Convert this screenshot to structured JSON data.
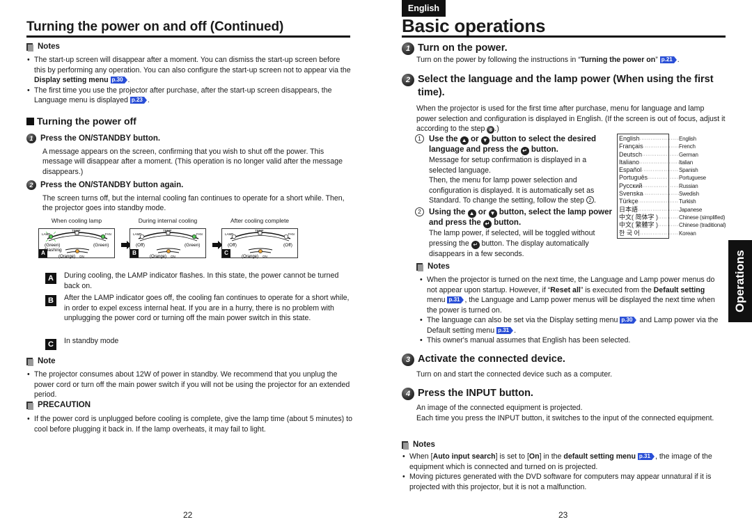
{
  "left_page": {
    "title": "Turning the power on and off (Continued)",
    "notes1": {
      "heading": "Notes",
      "items": [
        {
          "pre": "The start-up screen will disappear after a moment. You can dismiss the start-up screen before this by performing any operation. You can also configure the start-up screen not to appear via the ",
          "bold": "Display setting menu",
          "ref": "p.30",
          "post": "."
        },
        {
          "pre": "The first time you use the projector after purchase, after the start-up screen disappears, the Language menu is displayed",
          "bold": "",
          "ref": "p.23",
          "post": "."
        }
      ]
    },
    "section_off": {
      "heading": "Turning the power off",
      "steps": [
        {
          "num": "1",
          "title": "Press the ON/STANDBY button.",
          "text": "A message appears on the screen, confirming that you wish to shut off the power. This message will disappear after a moment. (This operation is no longer valid after the message disappears.)"
        },
        {
          "num": "2",
          "title": "Press the ON/STANDBY button again.",
          "text": "The screen turns off, but the internal cooling fan continues to operate for a short while. Then, the projector goes into standby mode."
        }
      ]
    },
    "diagrams": [
      {
        "caption": "When cooling lamp",
        "letter": "A",
        "lamp": "(Green)",
        "fan": "(Green)",
        "flashing": "Flashing",
        "on": "(Orange)",
        "lamp_color": "#58c85a",
        "fan_color": "#58c85a"
      },
      {
        "caption": "During internal cooling",
        "letter": "B",
        "lamp": "(Off)",
        "fan": "(Green)",
        "flashing": "",
        "on": "(Orange)",
        "lamp_color": "#ffffff",
        "fan_color": "#58c85a"
      },
      {
        "caption": "After cooling complete",
        "letter": "C",
        "lamp": "(Off)",
        "fan": "(Off)",
        "flashing": "",
        "on": "(Orange)",
        "lamp_color": "#ffffff",
        "fan_color": "#ffffff"
      }
    ],
    "indicator_labels": {
      "temp": "TEMP",
      "lamp": "LAMP",
      "fan": "FAN",
      "on": "ON"
    },
    "indicator_colors": {
      "orange": "#e8a23a",
      "green": "#58c85a"
    },
    "states": [
      {
        "letter": "A",
        "text": "During cooling, the LAMP indicator flashes. In this state, the power cannot be turned back on."
      },
      {
        "letter": "B",
        "text": "After the LAMP indicator goes off, the cooling fan continues to operate for a short while, in order to expel excess internal heat. If you are in a hurry, there is no problem with unplugging the power cord or turning off the main power switch in this state."
      },
      {
        "letter": "C",
        "text": "In standby mode"
      }
    ],
    "note2": {
      "heading": "Note",
      "items": [
        "The projector consumes about 12W of power in standby. We recommend that you unplug the power cord or turn off the main power switch if you will not be using the projector for an extended period."
      ]
    },
    "precaution": {
      "heading": "PRECAUTION",
      "items": [
        "If the power cord is unplugged before cooling is complete, give the lamp time (about 5 minutes) to cool before plugging it back in. If the lamp overheats, it may fail to light."
      ]
    },
    "page_number": "22"
  },
  "right_page": {
    "language_tab": "English",
    "title": "Basic operations",
    "side_tab": "Operations",
    "step1": {
      "num": "1",
      "title": "Turn on the power.",
      "pre": "Turn on the power by following the instructions in “",
      "bold": "Turning the power on",
      "post": "”",
      "ref": "p.21",
      "end": "."
    },
    "step2": {
      "num": "2",
      "title": "Select the language and the lamp power (When using the first time).",
      "text_pre": "When the projector is used for the first time after purchase, menu for language and lamp power selection and configuration is displayed in English. (If the screen is out of focus, adjust it according to the step ",
      "text_step": "6",
      "text_post": ".)",
      "sub1": {
        "num": "1",
        "title_a": "Use the",
        "title_or": "or",
        "title_b": "button to select the desired language and press the",
        "title_c": "button.",
        "text1": "Message for setup confirmation is displayed in a selected language.",
        "text2": "Then, the menu for lamp power selection and configuration is displayed. It is automatically set as Standard. To change the setting, follow the step",
        "text2_ref": "2",
        "text2_end": "."
      },
      "sub2": {
        "num": "2",
        "title_a": "Using the",
        "title_or": "or",
        "title_b": "button, select the lamp power and press the",
        "title_c": "button.",
        "text_a": "The lamp power, if selected, will be toggled without pressing the",
        "text_b": "button. The display automatically disappears in a few seconds."
      },
      "languages": [
        {
          "native": "English",
          "english": "English"
        },
        {
          "native": "Français",
          "english": "French"
        },
        {
          "native": "Deutsch",
          "english": "German"
        },
        {
          "native": "Italiano",
          "english": "Italian"
        },
        {
          "native": "Español",
          "english": "Spanish"
        },
        {
          "native": "Português",
          "english": "Portuguese"
        },
        {
          "native": "Русский",
          "english": "Russian"
        },
        {
          "native": "Svenska",
          "english": "Swedish"
        },
        {
          "native": "Türkçe",
          "english": "Turkish"
        },
        {
          "native": "日本語",
          "english": "Japanese"
        },
        {
          "native": "中文( 简体字 )",
          "english": "Chinese (simplified)"
        },
        {
          "native": "中文( 繁體字 )",
          "english": "Chinese (traditional)"
        },
        {
          "native": "한 국 어",
          "english": "Korean"
        }
      ],
      "notes": {
        "heading": "Notes",
        "item1": {
          "a": "When the projector is turned on the next time, the Language and Lamp power menus do not appear upon startup. However, if “",
          "b": "Reset all",
          "c": "” is executed from the ",
          "d": "Default setting",
          "e": " menu",
          "ref": "p.31",
          "f": ", the Language and Lamp power menus will be displayed the next time when the power is turned on."
        },
        "item2": {
          "a": "The language can also be set via the Display setting menu",
          "ref1": "p.30",
          "b": "and Lamp power via the Default setting menu",
          "ref2": "p.31",
          "c": "."
        },
        "item3": "This owner's manual assumes that English has been selected."
      }
    },
    "step3": {
      "num": "3",
      "title": "Activate the connected device.",
      "text": "Turn on and start the connected device such as a computer."
    },
    "step4": {
      "num": "4",
      "title": "Press the INPUT button.",
      "text1": "An image of the connected equipment is projected.",
      "text2": "Each time you press the INPUT button, it switches to the input of the connected equipment."
    },
    "notes_bottom": {
      "heading": "Notes",
      "item1": {
        "a": "When [",
        "b": "Auto input search",
        "c": "] is set to [",
        "d": "On",
        "e": "] in the ",
        "f": "default setting menu",
        "ref": "p.31",
        "g": ", the image of the equipment which is connected and turned on is projected."
      },
      "item2": "Moving pictures generated with the DVD software for computers may appear unnatural if it is projected with this projector, but it is not a malfunction."
    },
    "page_number": "23"
  },
  "glyphs": {
    "up_button": "▲",
    "down_button": "▼",
    "enter_button": "↵"
  }
}
